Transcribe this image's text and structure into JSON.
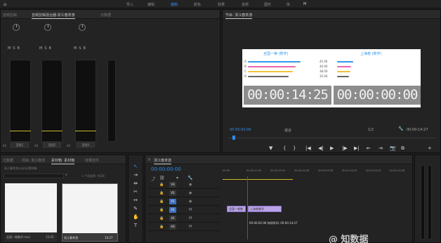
{
  "top_bar": {
    "home_icon": "home-icon",
    "tabs": [
      "导入",
      "编辑",
      "编辑",
      "颜色",
      "效果",
      "音频",
      "图形",
      "库"
    ],
    "active_index": 2,
    "extra": "M"
  },
  "audio_mixer": {
    "tabs": [
      "音频剪辑",
      "音频剪辑混合器:浙江春茶游",
      "元数据"
    ],
    "channels": [
      {
        "name": "A1",
        "label": "音频1",
        "msb": [
          "M",
          "S",
          "B"
        ]
      },
      {
        "name": "A2",
        "label": "音频2",
        "msb": [
          "M",
          "S",
          "B"
        ]
      },
      {
        "name": "A3",
        "label": "音频3",
        "msb": [
          "M",
          "S",
          "B"
        ]
      }
    ],
    "db_ticks": [
      "0",
      "-6",
      "-12",
      "-18",
      "-24",
      "-30",
      "-36",
      "-42",
      "-48",
      "-54"
    ]
  },
  "program": {
    "title": "节目: 浙江春茶游",
    "left_header": "全国一等 (数学)",
    "right_header": "上海卷 (数学)",
    "rows": [
      {
        "label": "A",
        "value": "45.00",
        "color": "#3399ee",
        "fill": 0.75
      },
      {
        "label": "B",
        "value": "40.00",
        "color": "#ee66aa",
        "fill": 0.68
      },
      {
        "label": "C",
        "value": "38.00",
        "color": "#f2c23a",
        "fill": 0.64
      },
      {
        "label": "D",
        "value": "35.00",
        "color": "#666666",
        "fill": 0.58
      }
    ],
    "tc_left": "00:00:14:25",
    "tc_right": "00:00:00:00",
    "current_tc": "00:00:02:06",
    "fit": "适合",
    "quality": "1/2",
    "duration": "00:00:14:27",
    "controls": [
      "▼",
      "{",
      "}",
      "|◀",
      "◀|",
      "▶",
      "|▶",
      "▶|",
      "⇤",
      "⇥",
      "📷",
      "⧉",
      "+"
    ]
  },
  "project": {
    "tabs": [
      "元数据",
      "项目: 浙江春茶",
      "素材箱: 素材箱",
      "效果控件"
    ],
    "path": "浙江春茶游.prproj\\素材箱",
    "count": "1 个项选择, 共2项",
    "thumbs": [
      {
        "name": "全国一卷数学.mov",
        "duration": "15:05"
      },
      {
        "name": "浙江春茶游",
        "duration": "14:27"
      }
    ]
  },
  "timeline": {
    "title": "浙江春茶游",
    "current": "00:00:00:00",
    "ruler": [
      "00:00",
      "00:00:14:29",
      "00:00:29:29",
      "00:00:44:28",
      "00:00:59:28",
      "00:01:14:29",
      "00:01:29:29",
      "00:01:44:28"
    ],
    "tracks": [
      "V3",
      "V2",
      "V1",
      "A1",
      "A2",
      "A3"
    ],
    "clips": [
      {
        "label": "全国一卷数",
        "start": 2,
        "end": 11
      },
      {
        "label": "上海卷数学",
        "start": 12,
        "end": 28
      }
    ],
    "tooltip": "00:00:02:06 持续时间: 00:00:14:27"
  },
  "watermark": "@ 知数据"
}
